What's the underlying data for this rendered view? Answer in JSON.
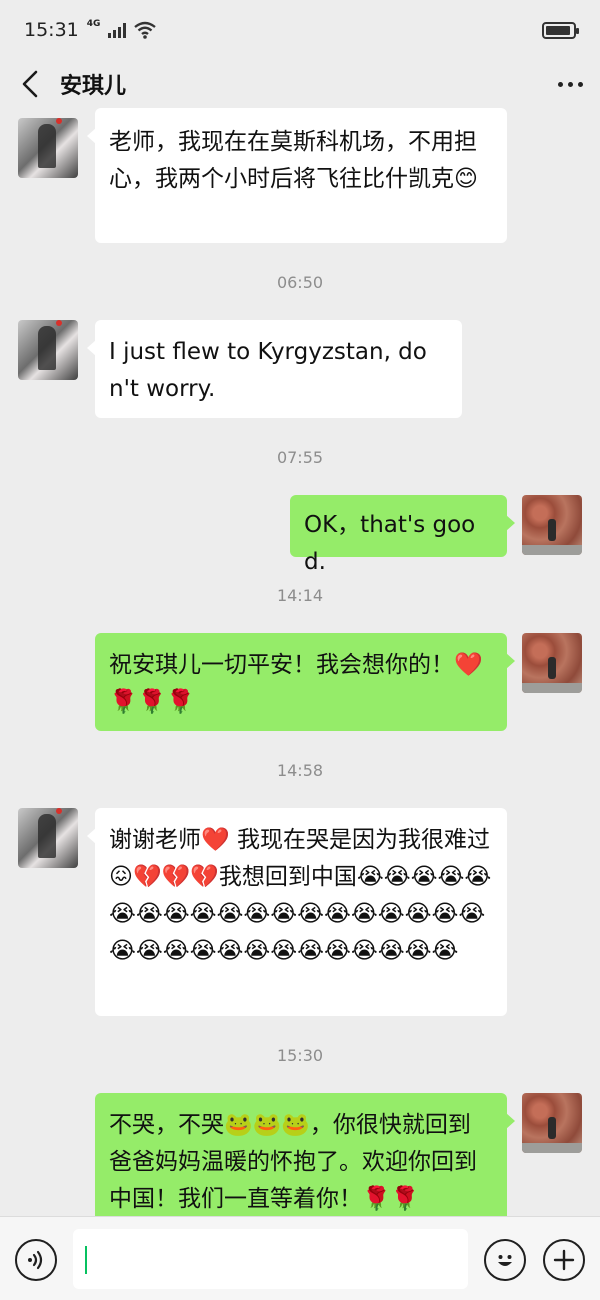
{
  "status": {
    "time": "15:31",
    "network": "4G"
  },
  "header": {
    "title": "安琪儿"
  },
  "messages": [
    {
      "type": "in",
      "text": "老师，我现在在莫斯科机场，不用担心，我两个小时后将飞往比什凯克😊"
    },
    {
      "type": "time",
      "text": "06:50"
    },
    {
      "type": "in",
      "text": "I just flew to Kyrgyzstan, don't worry."
    },
    {
      "type": "time",
      "text": "07:55"
    },
    {
      "type": "out",
      "text": "OK，that's good."
    },
    {
      "type": "time",
      "text": "14:14"
    },
    {
      "type": "out",
      "text": "祝安琪儿一切平安！我会想你的！❤️🌹🌹🌹"
    },
    {
      "type": "time",
      "text": "14:58"
    },
    {
      "type": "in",
      "text": "谢谢老师❤️ 我现在哭是因为我很难过😖💔💔💔我想回到中国😭😭😭😭😭😭😭😭😭😭😭😭😭😭😭😭😭😭😭😭😭😭😭😭😭😭😭😭😭😭😭😭"
    },
    {
      "type": "time",
      "text": "15:30"
    },
    {
      "type": "out",
      "text": "不哭，不哭🐸🐸🐸，你很快就回到爸爸妈妈温暖的怀抱了。欢迎你回到中国！我们一直等着你！🌹🌹"
    }
  ],
  "input": {
    "value": ""
  },
  "icons": {
    "back": "chevron-left-icon",
    "more": "more-dots-icon",
    "voice": "voice-icon",
    "emoji": "smiley-icon",
    "plus": "plus-icon"
  },
  "colors": {
    "outgoing_bubble": "#95ec69",
    "incoming_bubble": "#ffffff",
    "background": "#ededed"
  }
}
